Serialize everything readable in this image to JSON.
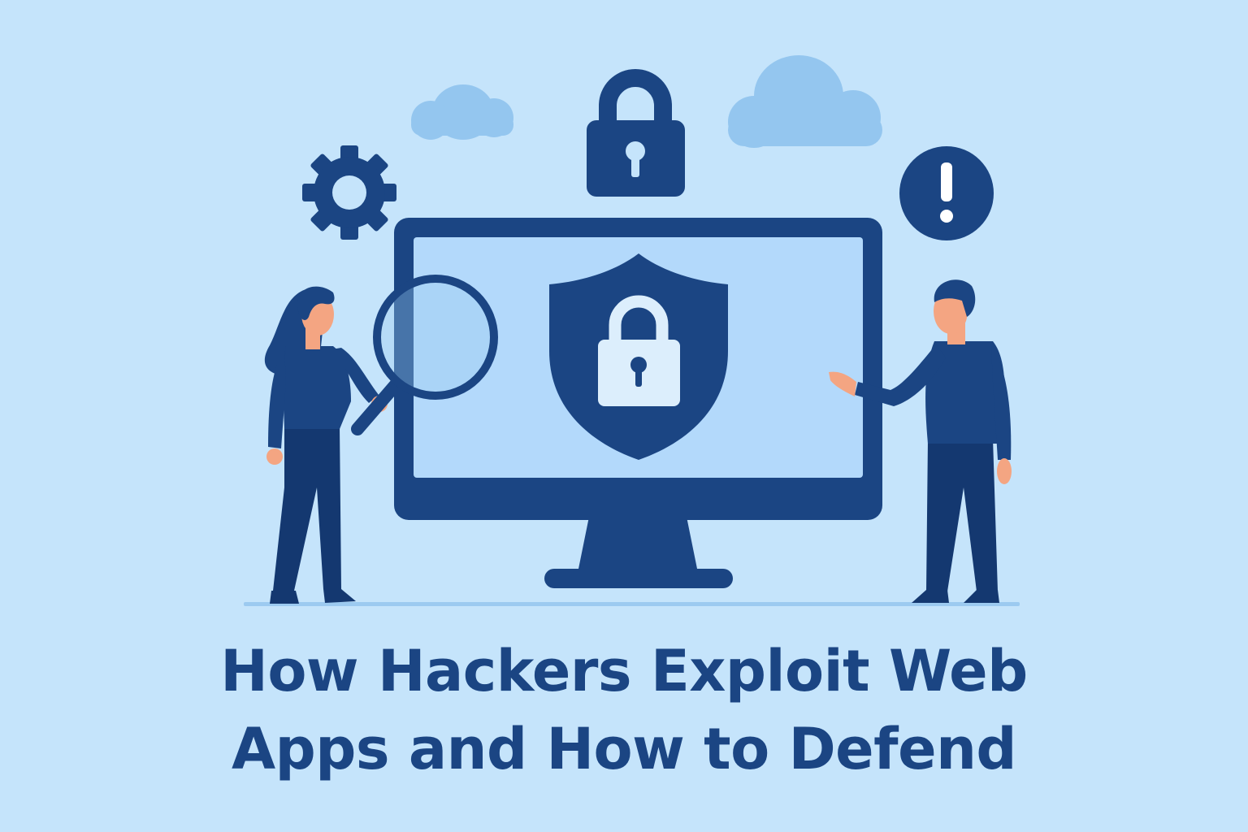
{
  "headline": {
    "line1": "How Hackers Exploit Web",
    "line2": "Apps and How to Defend"
  },
  "colors": {
    "background": "#c5e4fb",
    "navy": "#1b4583",
    "dark_navy": "#143870",
    "screen": "#b3d9fb",
    "cloud": "#94c6ef",
    "skin": "#f4a582",
    "ground": "#9ccaf0",
    "keyhole_plate": "#dceefc"
  },
  "icons": [
    "gear-icon",
    "padlock-icon",
    "cloud-icon",
    "warning-icon",
    "shield-lock-icon",
    "magnifying-glass-icon",
    "monitor-icon"
  ]
}
